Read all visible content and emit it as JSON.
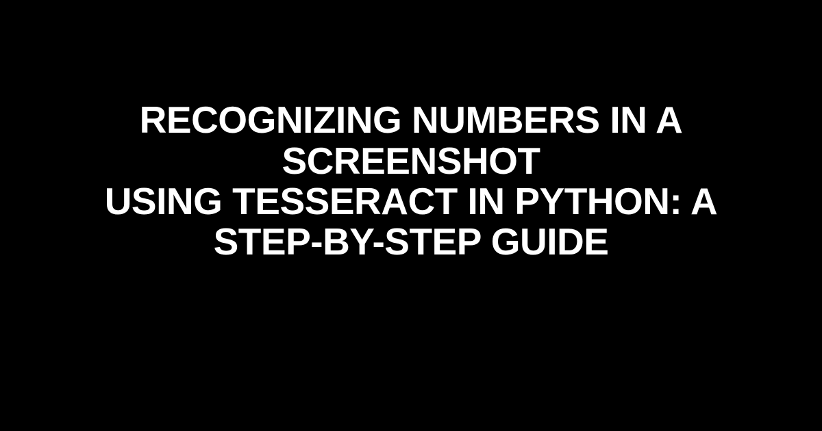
{
  "title": {
    "line1": "Recognizing Numbers in a Screenshot",
    "line2": "using Tesseract in Python: A",
    "line3": "Step-by-Step Guide"
  }
}
